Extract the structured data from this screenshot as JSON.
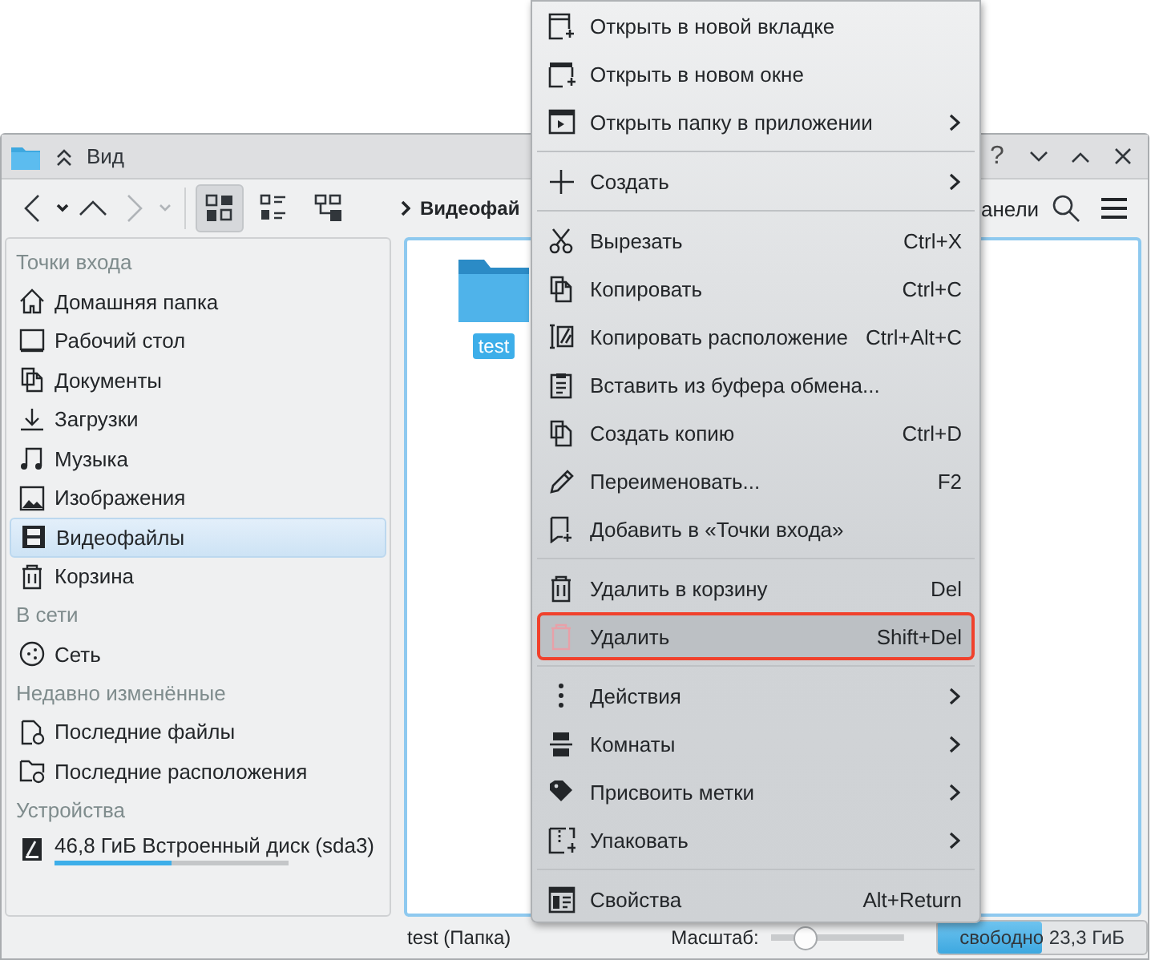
{
  "window": {
    "title": "Вид",
    "buttons": [
      "?"
    ]
  },
  "toolbar": {
    "breadcrumb": "Видеофай",
    "panels_label": "анели",
    "view_modes": [
      {
        "selected": true
      },
      {
        "selected": false
      },
      {
        "selected": false
      }
    ]
  },
  "sidebar": {
    "sections": [
      {
        "title": "Точки входа",
        "items": [
          {
            "label": "Домашняя папка",
            "selected": false
          },
          {
            "label": "Рабочий стол",
            "selected": false
          },
          {
            "label": "Документы",
            "selected": false
          },
          {
            "label": "Загрузки",
            "selected": false
          },
          {
            "label": "Музыка",
            "selected": false
          },
          {
            "label": "Изображения",
            "selected": false
          },
          {
            "label": "Видеофайлы",
            "selected": true
          },
          {
            "label": "Корзина",
            "selected": false
          }
        ]
      },
      {
        "title": "В сети",
        "items": [
          {
            "label": "Сеть",
            "selected": false
          }
        ]
      },
      {
        "title": "Недавно изменённые",
        "items": [
          {
            "label": "Последние файлы",
            "selected": false
          },
          {
            "label": "Последние расположения",
            "selected": false
          }
        ]
      },
      {
        "title": "Устройства",
        "items": [
          {
            "label": "46,8 ГиБ Встроенный диск (sda3)",
            "selected": false,
            "level": 0.5
          }
        ]
      }
    ]
  },
  "content": {
    "files": [
      {
        "name": "test",
        "selected": true
      }
    ]
  },
  "status_bar": {
    "selection": "test (Папка)",
    "zoom_label": "Масштаб:",
    "zoom": {
      "level": 0.25
    },
    "free_space": {
      "label": "свободно 23,3 ГиБ",
      "level": 0.5
    }
  },
  "context_menu": {
    "items": [
      {
        "kind": "item",
        "label": "Открыть в новой вкладке",
        "selected": false
      },
      {
        "kind": "item",
        "label": "Открыть в новом окне",
        "selected": false
      },
      {
        "kind": "item",
        "label": "Открыть папку в приложении",
        "submenu": true,
        "selected": false
      },
      {
        "kind": "separator"
      },
      {
        "kind": "item",
        "label": "Создать",
        "submenu": true,
        "selected": false
      },
      {
        "kind": "separator"
      },
      {
        "kind": "item",
        "label": "Вырезать",
        "shortcut": "Ctrl+X",
        "selected": false
      },
      {
        "kind": "item",
        "label": "Копировать",
        "shortcut": "Ctrl+C",
        "selected": false
      },
      {
        "kind": "item",
        "label": "Копировать расположение",
        "shortcut": "Ctrl+Alt+C",
        "selected": false
      },
      {
        "kind": "item",
        "label": "Вставить из буфера обмена...",
        "selected": false
      },
      {
        "kind": "item",
        "label": "Создать копию",
        "shortcut": "Ctrl+D",
        "selected": false
      },
      {
        "kind": "item",
        "label": "Переименовать...",
        "shortcut": "F2",
        "selected": false
      },
      {
        "kind": "item",
        "label": "Добавить в «Точки входа»",
        "selected": false
      },
      {
        "kind": "separator"
      },
      {
        "kind": "item",
        "label": "Удалить в корзину",
        "shortcut": "Del",
        "selected": false
      },
      {
        "kind": "item",
        "label": "Удалить",
        "shortcut": "Shift+Del",
        "selected": true
      },
      {
        "kind": "separator"
      },
      {
        "kind": "item",
        "label": "Действия",
        "submenu": true,
        "selected": false
      },
      {
        "kind": "item",
        "label": "Комнаты",
        "submenu": true,
        "selected": false
      },
      {
        "kind": "item",
        "label": "Присвоить метки",
        "submenu": true,
        "selected": false
      },
      {
        "kind": "item",
        "label": "Упаковать",
        "submenu": true,
        "selected": false
      },
      {
        "kind": "separator"
      },
      {
        "kind": "item",
        "label": "Свойства",
        "shortcut": "Alt+Return",
        "selected": false
      }
    ]
  }
}
